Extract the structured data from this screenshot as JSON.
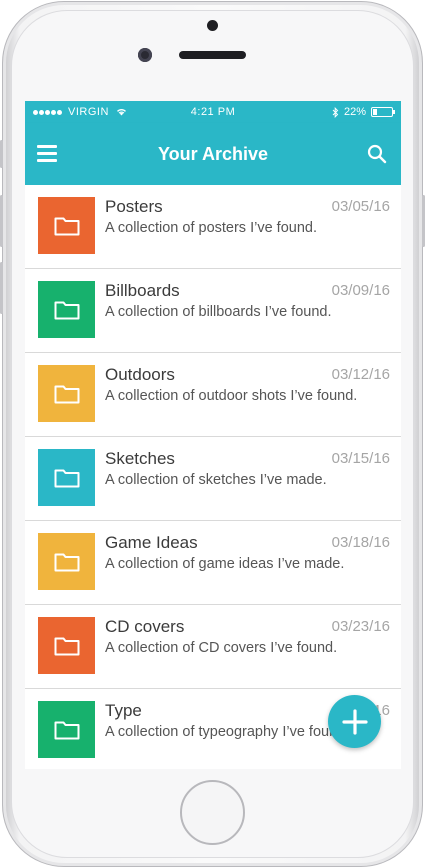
{
  "status_bar": {
    "carrier": "VIRGIN",
    "time": "4:21 PM",
    "battery": "22%",
    "battery_level": 0.22
  },
  "app_bar": {
    "title": "Your Archive",
    "menu_icon": "hamburger-menu-icon",
    "search_icon": "search-icon"
  },
  "colors": {
    "accent": "#2ab7c7",
    "orange": "#ea6530",
    "green": "#17b16d",
    "yellow": "#f0b43d",
    "teal": "#2ab7c7"
  },
  "items": [
    {
      "title": "Posters",
      "date": "03/05/16",
      "description": "A collection of posters I’ve found.",
      "color": "#ea6530",
      "icon": "folder-icon"
    },
    {
      "title": "Billboards",
      "date": "03/09/16",
      "description": "A collection of billboards I’ve found.",
      "color": "#17b16d",
      "icon": "folder-icon"
    },
    {
      "title": "Outdoors",
      "date": "03/12/16",
      "description": "A collection of outdoor shots I’ve found.",
      "color": "#f0b43d",
      "icon": "folder-icon"
    },
    {
      "title": "Sketches",
      "date": "03/15/16",
      "description": "A collection of sketches I’ve made.",
      "color": "#2ab7c7",
      "icon": "folder-icon"
    },
    {
      "title": "Game Ideas",
      "date": "03/18/16",
      "description": "A collection of game ideas I’ve made.",
      "color": "#f0b43d",
      "icon": "folder-icon"
    },
    {
      "title": "CD covers",
      "date": "03/23/16",
      "description": "A collection of CD covers I’ve found.",
      "color": "#ea6530",
      "icon": "folder-icon"
    },
    {
      "title": "Type",
      "date": "03/26/16",
      "description": "A collection of typeography I’ve found.",
      "color": "#17b16d",
      "icon": "folder-icon"
    }
  ],
  "fab": {
    "icon": "plus-icon"
  }
}
